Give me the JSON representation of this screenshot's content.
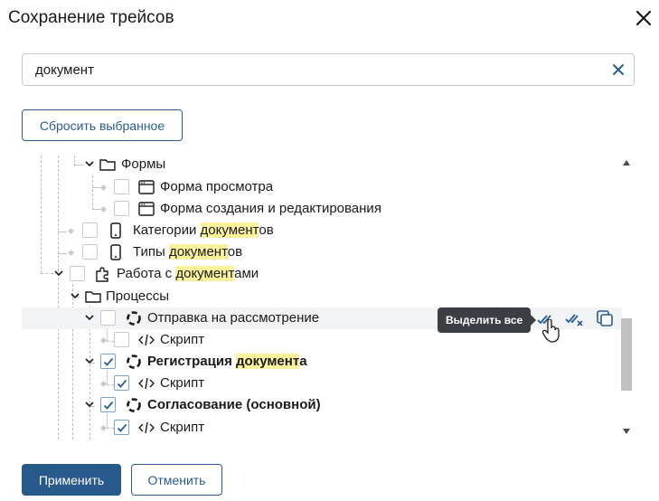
{
  "dialog": {
    "title": "Сохранение трейсов",
    "close_icon": "close-icon"
  },
  "search": {
    "value": "документ",
    "clear_icon": "clear-icon"
  },
  "reset_label": "Сбросить выбранное",
  "tree": [
    {
      "pre": "",
      "hl": "",
      "post": "Формы",
      "icon": "folder-icon",
      "checked": null
    },
    {
      "pre": "",
      "hl": "",
      "post": "Форма просмотра",
      "icon": "form-icon",
      "checked": false
    },
    {
      "pre": "",
      "hl": "",
      "post": "Форма создания и редактирования",
      "icon": "form-icon",
      "checked": false
    },
    {
      "pre": "Категории ",
      "hl": "документ",
      "post": "ов",
      "icon": "mobile-icon",
      "checked": false
    },
    {
      "pre": "Типы ",
      "hl": "документ",
      "post": "ов",
      "icon": "mobile-icon",
      "checked": false
    },
    {
      "pre": "Работа с ",
      "hl": "документ",
      "post": "ами",
      "icon": "puzzle-icon",
      "checked": false
    },
    {
      "pre": "",
      "hl": "",
      "post": "Процессы",
      "icon": "folder-icon",
      "checked": null
    },
    {
      "pre": "",
      "hl": "",
      "post": "Отправка на рассмотрение",
      "icon": "process-icon",
      "checked": false
    },
    {
      "pre": "",
      "hl": "",
      "post": "Скрипт",
      "icon": "code-icon",
      "checked": false
    },
    {
      "pre": "Регистрация ",
      "hl": "документ",
      "post": "а",
      "icon": "process-icon",
      "checked": true
    },
    {
      "pre": "",
      "hl": "",
      "post": "Скрипт",
      "icon": "code-icon",
      "checked": true
    },
    {
      "pre": "",
      "hl": "",
      "post": "Согласование (основной)",
      "icon": "process-icon",
      "checked": true
    },
    {
      "pre": "",
      "hl": "",
      "post": "Скрипт",
      "icon": "code-icon",
      "checked": true
    }
  ],
  "row_actions": {
    "tooltip": "Выделить все",
    "icons": [
      "select-all-icon",
      "deselect-all-icon",
      "copy-icon"
    ]
  },
  "footer": {
    "apply_label": "Применить",
    "cancel_label": "Отменить"
  },
  "colors": {
    "accent": "#27598a",
    "highlight": "#fcf29c",
    "tooltip_bg": "#3b3e42"
  }
}
